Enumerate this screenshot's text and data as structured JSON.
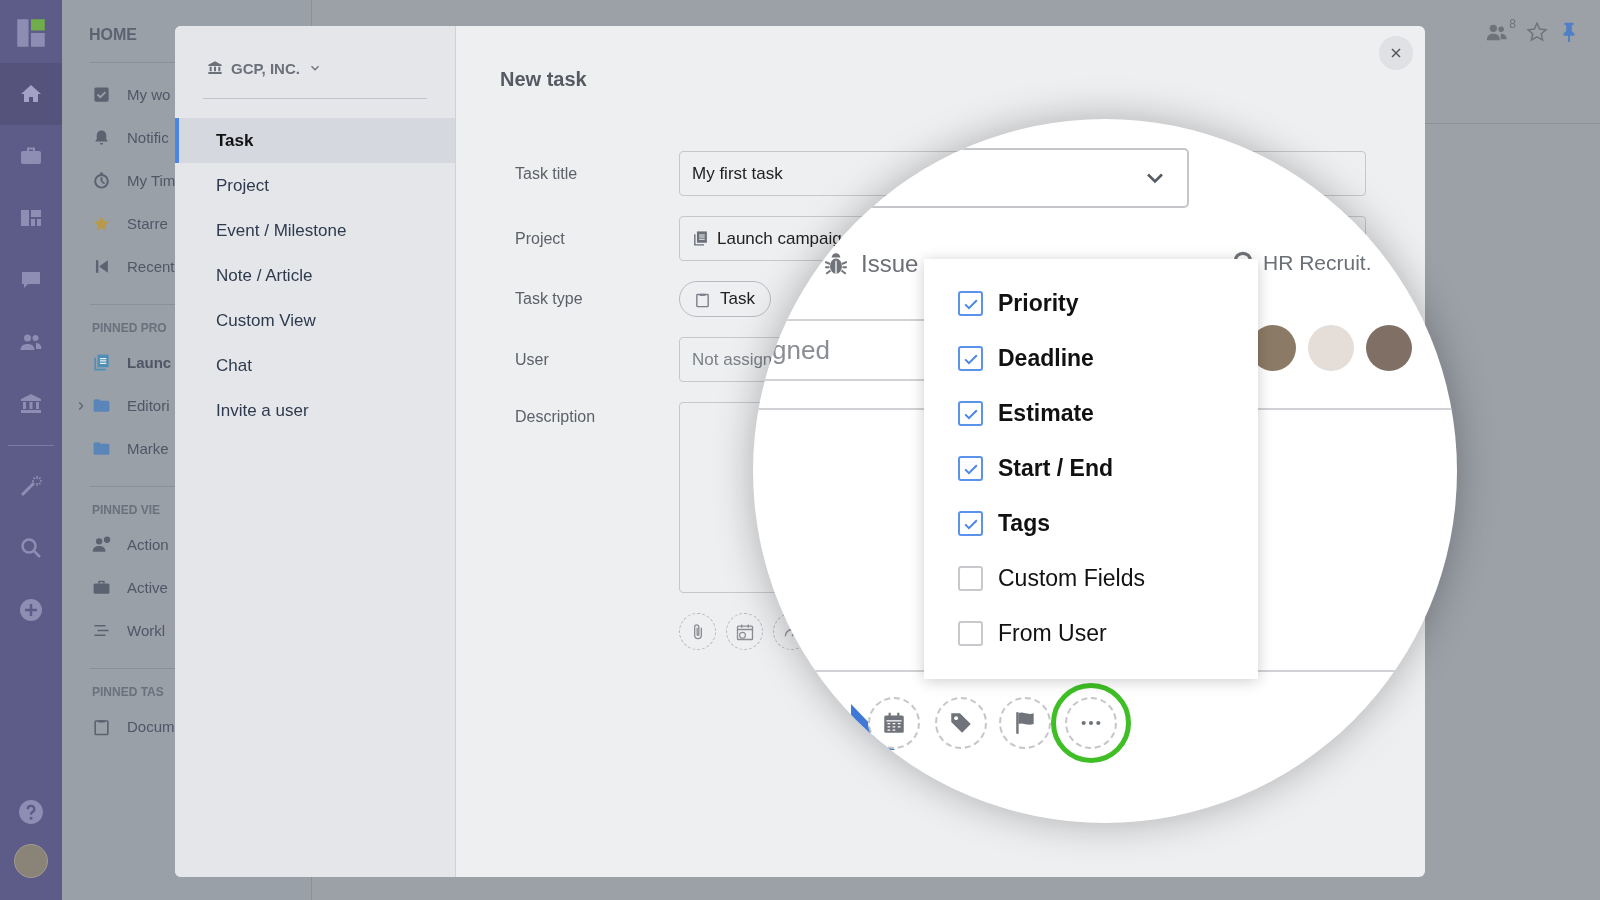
{
  "rail": {
    "items": [
      {
        "selected": true
      },
      {
        "selected": false
      },
      {
        "selected": false
      },
      {
        "selected": false
      },
      {
        "selected": false
      },
      {
        "selected": false
      },
      {
        "selected": false
      },
      {
        "selected": false
      },
      {
        "selected": false
      }
    ]
  },
  "home": {
    "title": "HOME",
    "items": [
      {
        "label": "My wo"
      },
      {
        "label": "Notific"
      },
      {
        "label": "My Tim"
      },
      {
        "label": "Starre"
      },
      {
        "label": "Recent"
      }
    ],
    "sections": [
      {
        "title": "PINNED PRO",
        "items": [
          {
            "label": "Launc",
            "active": true,
            "collapsible": false
          },
          {
            "label": "Editori",
            "active": false,
            "collapsible": true
          },
          {
            "label": "Marke",
            "active": false,
            "collapsible": false
          }
        ]
      },
      {
        "title": "PINNED VIE",
        "items": [
          {
            "label": "Action",
            "active": false,
            "collapsible": false
          },
          {
            "label": "Active",
            "active": false,
            "collapsible": false
          },
          {
            "label": "Workl",
            "active": false,
            "collapsible": false
          }
        ]
      },
      {
        "title": "PINNED TAS",
        "items": [
          {
            "label": "Docum",
            "active": false,
            "collapsible": false
          }
        ]
      }
    ]
  },
  "toolbar": {
    "members_count": "8",
    "starred": false,
    "pinned": true
  },
  "dialog": {
    "org": "GCP, INC.",
    "menu": [
      {
        "label": "Task",
        "selected": true
      },
      {
        "label": "Project",
        "selected": false
      },
      {
        "label": "Event / Milestone",
        "selected": false
      },
      {
        "label": "Note / Article",
        "selected": false
      },
      {
        "label": "Custom View",
        "selected": false
      },
      {
        "label": "Chat",
        "selected": false
      },
      {
        "label": "Invite a user",
        "selected": false
      }
    ],
    "title": "New task",
    "fields": [
      {
        "kind": "text",
        "label": "Task title",
        "value": "My first task"
      },
      {
        "kind": "project",
        "label": "Project",
        "value": "Launch campaig"
      },
      {
        "kind": "chips",
        "label": "Task type",
        "chips": [
          {
            "label": "Task"
          }
        ]
      },
      {
        "kind": "user",
        "label": "User",
        "placeholder": "Not assign"
      },
      {
        "kind": "textarea",
        "label": "Description"
      }
    ]
  },
  "magnifier": {
    "type_options": [
      {
        "label": "Issue"
      },
      {
        "label": "HR Recruit."
      }
    ],
    "user_placeholder": "gned",
    "options_menu": {
      "items": [
        {
          "label": "Priority",
          "checked": true
        },
        {
          "label": "Deadline",
          "checked": true
        },
        {
          "label": "Estimate",
          "checked": true
        },
        {
          "label": "Start / End",
          "checked": true
        },
        {
          "label": "Tags",
          "checked": true
        },
        {
          "label": "Custom Fields",
          "checked": false
        },
        {
          "label": "From User",
          "checked": false
        }
      ]
    },
    "more_button": {
      "highlighted": true
    }
  }
}
